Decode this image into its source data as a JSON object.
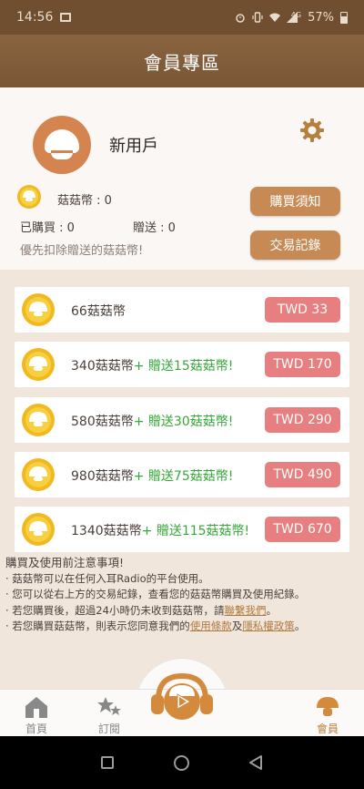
{
  "status_bar": {
    "time": "14:56",
    "battery": "57%",
    "network": "4G",
    "icons": [
      "image-icon",
      "alarm-icon",
      "vibrate-icon",
      "wifi-icon",
      "signal-icon",
      "battery-icon"
    ]
  },
  "header": {
    "title": "會員專區"
  },
  "profile": {
    "username": "新用戶",
    "balance_label": "菇菇幣 : 0",
    "purchased_label": "已購買 : 0",
    "gifted_label": "贈送 : 0",
    "priority_note": "優先扣除贈送的菇菇幣!",
    "notice_button": "購買須知",
    "records_button": "交易記錄"
  },
  "packages": [
    {
      "name": "66菇菇幣",
      "bonus": "",
      "price": "TWD 33"
    },
    {
      "name": "340菇菇幣",
      "bonus": "+ 贈送15菇菇幣!",
      "price": "TWD 170"
    },
    {
      "name": "580菇菇幣",
      "bonus": "+ 贈送30菇菇幣!",
      "price": "TWD 290"
    },
    {
      "name": "980菇菇幣",
      "bonus": "+ 贈送75菇菇幣!",
      "price": "TWD 490"
    },
    {
      "name": "1340菇菇幣",
      "bonus": "+ 贈送115菇菇幣!",
      "price": "TWD 670"
    }
  ],
  "notes": {
    "heading": "購買及使用前注意事項!",
    "line1": "· 菇菇幣可以在任何入耳Radio的平台使用。",
    "line2": "· 您可以從右上方的交易紀錄，查看您的菇菇幣購買及使用紀錄。",
    "line3_prefix": "· 若您購買後，超過24小時仍未收到菇菇幣，請",
    "line3_link": "聯繫我們",
    "line3_suffix": "。",
    "line4_prefix": "· 若您購買菇菇幣，則表示您同意我們的",
    "terms_link": "使用條款",
    "line4_mid": "及",
    "privacy_link": "隱私權政策",
    "line4_suffix": "。"
  },
  "bottom_nav": {
    "home": "首頁",
    "subscribe": "訂閱",
    "member": "會員"
  },
  "colors": {
    "header_brown": "#7a5635",
    "button_brown": "#c88a55",
    "price_pink": "#e77e7f",
    "bonus_green": "#36a83a",
    "avatar_orange": "#d4844f",
    "active_tab": "#b77f3c"
  }
}
